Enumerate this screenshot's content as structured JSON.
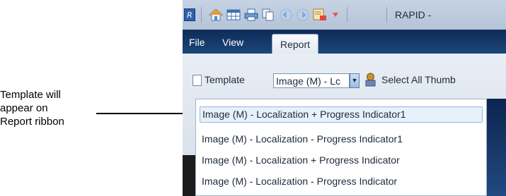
{
  "callout": {
    "lines": [
      "Template will",
      "appear on",
      "Report ribbon"
    ]
  },
  "toolbar": {
    "app_icon": "app-logo-icon",
    "icons": [
      "home-icon",
      "grid-icon",
      "print-icon",
      "copy-icon",
      "back-icon",
      "forward-icon",
      "report-icon",
      "dropdown-arrow-icon"
    ],
    "title": "RAPID  -"
  },
  "tabs": [
    {
      "label": "File",
      "active": false
    },
    {
      "label": "View",
      "active": false
    },
    {
      "label": "Report",
      "active": true
    }
  ],
  "ribbon": {
    "template_label": "Template",
    "template_value": "Image (M) - Lc",
    "select_all_label": "Select All Thumb"
  },
  "dropdown": {
    "items": [
      "Image (M) - Localization + Progress  Indicator1",
      "Image (M) - Localization - Progress Indicator1",
      "Image (M) - Localization + Progress  Indicator",
      "Image (M) - Localization - Progress Indicator"
    ],
    "selected_index": 0
  },
  "colors": {
    "tab_bar": "#0e2b57",
    "selection": "#e8f1fb",
    "ribbon": "#e9eef5"
  }
}
